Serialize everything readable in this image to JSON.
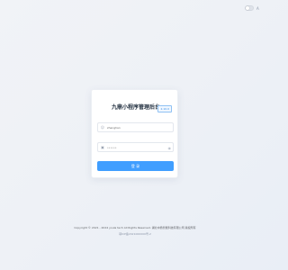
{
  "topbar": {
    "language_icon": "language-icon"
  },
  "login": {
    "title": "九鼎小程序管理后台",
    "version": "2.10.0",
    "username": {
      "value": "zhanghan",
      "icon": "user-icon"
    },
    "password": {
      "value": "••••••",
      "icon": "lock-icon",
      "eye_icon": "eye-icon"
    },
    "submit_label": "登 录"
  },
  "footer": {
    "copyright": "Copyright © 2021 - 2024 youla tech All Rights Reserved. 湖北中鼎智能科技有限公司 版权所有",
    "icp": "鄂ICP备2021000000号-2"
  }
}
